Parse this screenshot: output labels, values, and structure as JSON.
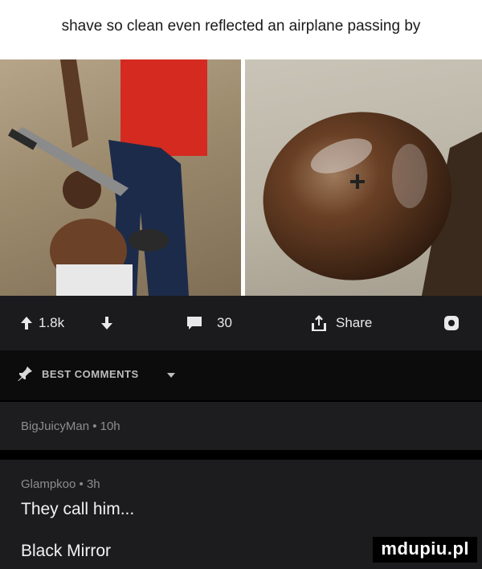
{
  "caption": "shave so clean even reflected an airplane passing by",
  "stats": {
    "upvotes": "1.8k",
    "comments": "30",
    "share_label": "Share"
  },
  "best_comments_label": "BEST COMMENTS",
  "comments": [
    {
      "author": "BigJuicyMan",
      "time": "10h",
      "meta": "BigJuicyMan • 10h",
      "text": ""
    },
    {
      "author": "Glampkoo",
      "time": "3h",
      "meta": "Glampkoo • 3h",
      "text": "They call him...",
      "text2": "Black Mirror"
    }
  ],
  "watermark": "mdupiu.pl",
  "colors": {
    "bar_bg": "#1b1b1d",
    "text": "#e9e9e9",
    "meta": "#8d8d8d"
  },
  "icons": [
    "upvote-arrow-icon",
    "downvote-arrow-icon",
    "comment-icon",
    "share-icon",
    "settings-icon",
    "pin-icon",
    "dropdown-caret-icon",
    "airplane-reflection-icon"
  ]
}
